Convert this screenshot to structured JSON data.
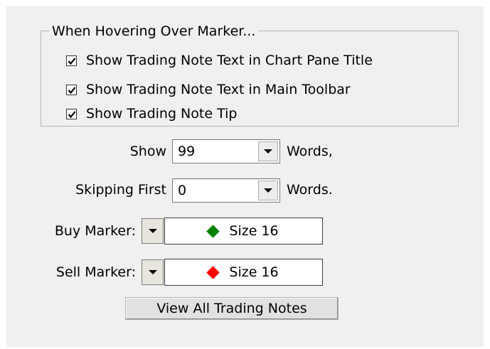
{
  "group": {
    "title": "When Hovering Over Marker...",
    "options": [
      {
        "label": "Show Trading Note Text in Chart Pane Title",
        "checked": true
      },
      {
        "label": "Show Trading Note Text in Main Toolbar",
        "checked": true
      },
      {
        "label": "Show Trading Note Tip",
        "checked": true
      }
    ]
  },
  "show_words": {
    "prefix": "Show",
    "value": "99",
    "suffix": "Words,"
  },
  "skip_words": {
    "prefix": "Skipping First",
    "value": "0",
    "suffix": "Words."
  },
  "buy_marker": {
    "label": "Buy Marker:",
    "size_text": "Size 16",
    "color": "#008000"
  },
  "sell_marker": {
    "label": "Sell Marker:",
    "size_text": "Size 16",
    "color": "#ff0000"
  },
  "view_button": {
    "label": "View All Trading Notes"
  }
}
